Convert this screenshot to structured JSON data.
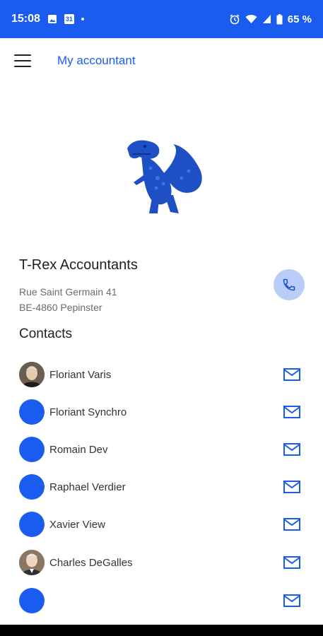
{
  "status_bar": {
    "time": "15:08",
    "calendar_day": "31",
    "battery": "65 %",
    "icons": [
      "image-icon",
      "calendar-icon",
      "dot-icon",
      "alarm-icon",
      "wifi-icon",
      "signal-icon",
      "battery-icon"
    ]
  },
  "app_bar": {
    "title": "My accountant",
    "menu_icon": "hamburger-menu-icon"
  },
  "firm": {
    "name": "T-Rex Accountants",
    "address_line1": "Rue Saint Germain 41",
    "address_line2": "BE-4860 Pepinster",
    "logo": "t-rex-dinosaur-logo",
    "call_icon": "phone-icon"
  },
  "contacts": {
    "heading": "Contacts",
    "items": [
      {
        "name": "Floriant Varis",
        "avatar": "photo"
      },
      {
        "name": "Floriant Synchro",
        "avatar": "blue-circle"
      },
      {
        "name": "Romain Dev",
        "avatar": "blue-circle"
      },
      {
        "name": "Raphael Verdier",
        "avatar": "blue-circle"
      },
      {
        "name": "Xavier View",
        "avatar": "blue-circle"
      },
      {
        "name": "Charles DeGalles",
        "avatar": "photo"
      },
      {
        "name": "",
        "avatar": "blue-circle"
      }
    ]
  },
  "colors": {
    "primary": "#1a5cf0",
    "call_button_bg": "#b9cdf8",
    "text": "#1f1f1f",
    "secondary_text": "#6b6b6b"
  }
}
